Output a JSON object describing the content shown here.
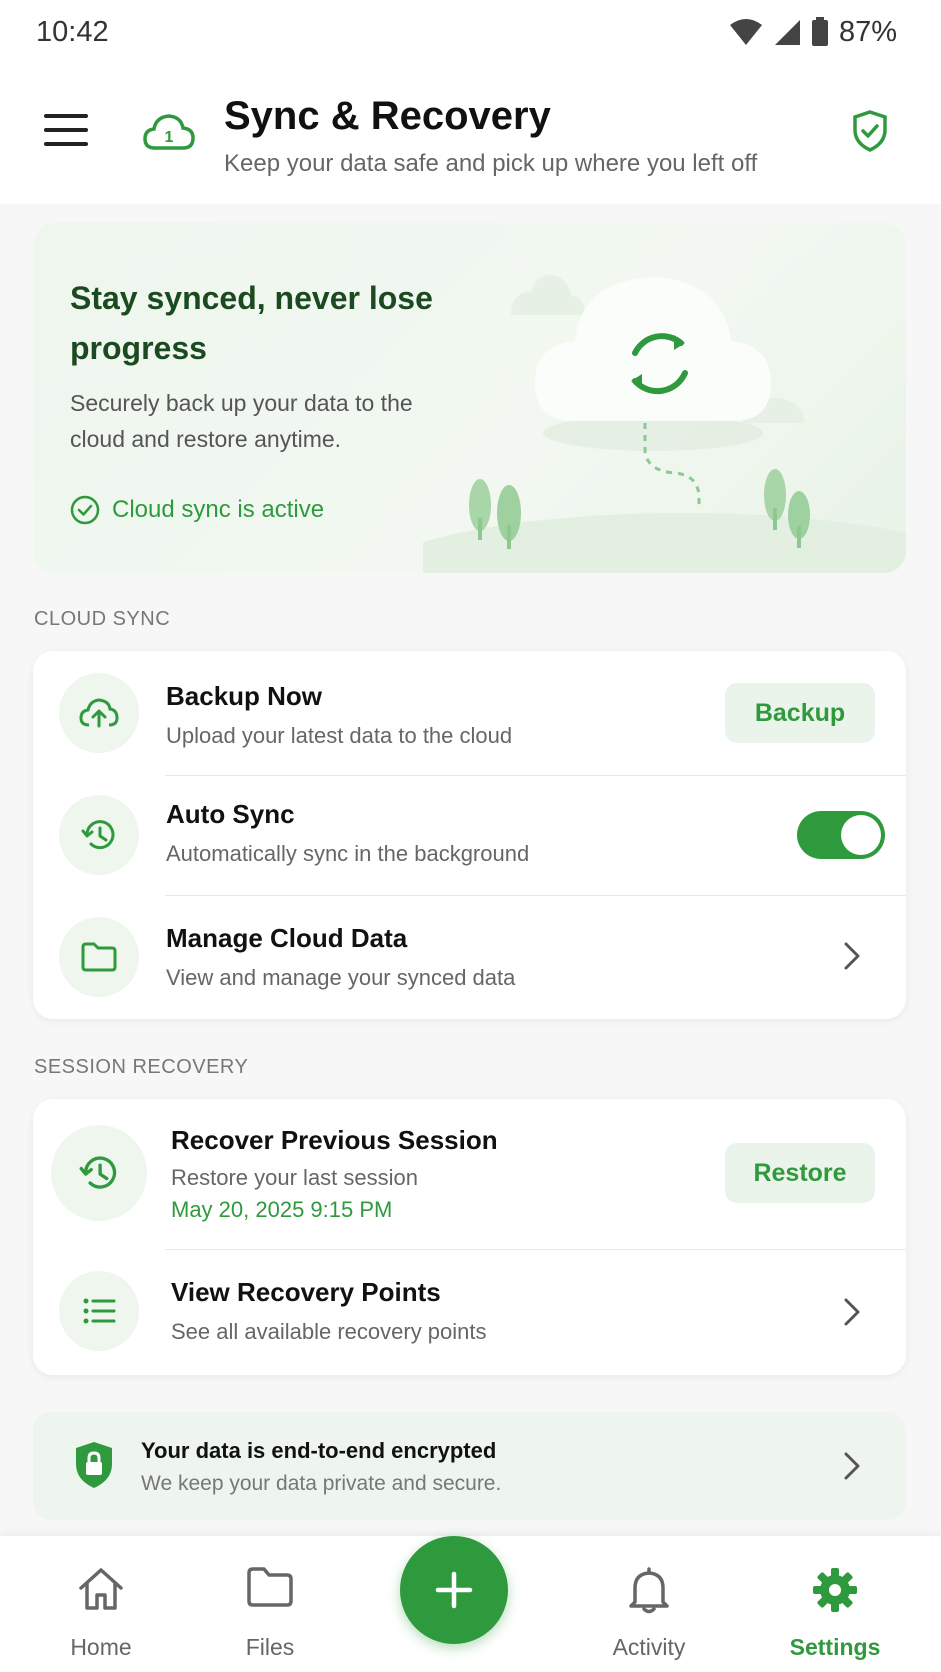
{
  "status_bar": {
    "time": "10:42",
    "battery": "87%"
  },
  "app_bar": {
    "title": "Sync & Recovery",
    "subtitle": "Keep your data safe and pick up where you left off",
    "cloud_badge": "1"
  },
  "hero": {
    "title": "Stay synced, never lose progress",
    "description": "Securely back up your data to the cloud and restore anytime.",
    "status": "Cloud sync is active"
  },
  "cloud_sync": {
    "label": "CLOUD SYNC",
    "backup": {
      "title": "Backup Now",
      "subtitle": "Upload your latest data to the cloud",
      "button": "Backup"
    },
    "auto_sync": {
      "title": "Auto Sync",
      "subtitle": "Automatically sync in the background",
      "enabled": true
    },
    "manage": {
      "title": "Manage Cloud Data",
      "subtitle": "View and manage your synced data"
    }
  },
  "session_recovery": {
    "label": "SESSION RECOVERY",
    "recover": {
      "title": "Recover Previous Session",
      "subtitle": "Restore your last session",
      "date": "May 20, 2025 9:15 PM",
      "button": "Restore"
    },
    "points": {
      "title": "View Recovery Points",
      "subtitle": "See all available recovery points"
    }
  },
  "encryption": {
    "title": "Your data is end-to-end encrypted",
    "subtitle": "We keep your data private and secure."
  },
  "bottom_nav": {
    "items": [
      {
        "label": "Home",
        "icon": "home-icon"
      },
      {
        "label": "Files",
        "icon": "folder-icon"
      },
      {
        "label": "Activity",
        "icon": "bell-icon"
      },
      {
        "label": "Settings",
        "icon": "gear-icon",
        "active": true
      }
    ],
    "fab_icon": "plus-icon"
  },
  "colors": {
    "accent": "#2f9a3d",
    "accent_light": "#eef6ee",
    "text": "#111111"
  }
}
